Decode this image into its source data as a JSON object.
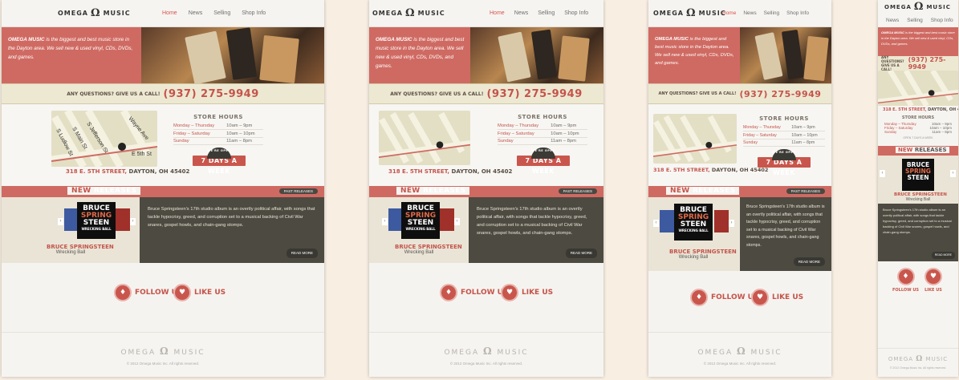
{
  "brand": {
    "name_left": "OMEGA",
    "symbol": "Ω",
    "name_right": "MUSIC"
  },
  "nav": [
    "Home",
    "News",
    "Selling",
    "Shop Info"
  ],
  "hero": {
    "brand": "OMEGA MUSIC",
    "text": "is the biggest and best music store in the Dayton area. We sell new & used vinyl, CDs, DVDs, and games."
  },
  "callbar": {
    "question": "ANY QUESTIONS? GIVE US A CALL!",
    "phone": "(937) 275-9949"
  },
  "map": {
    "streets": [
      "S Jefferson St",
      "S Main St",
      "S Ludlow St",
      "Wayne Ave",
      "E 5th St"
    ]
  },
  "address": {
    "street": "318 E. 5TH STREET,",
    "city": "DAYTON, OH 45402"
  },
  "hours": {
    "title": "STORE HOURS",
    "rows": [
      {
        "day": "Monday – Thursday",
        "time": "10am – 9pm"
      },
      {
        "day": "Friday – Saturday",
        "time": "10am – 10pm"
      },
      {
        "day": "Sunday",
        "time": "11am – 8pm"
      }
    ],
    "open_small": "WE'RE OPEN",
    "open_big": "7 DAYS A WEEK",
    "open_mobile": "OPEN 7 DAYS A WEEK"
  },
  "releases": {
    "title_new": "NEW",
    "title_rest": "RELEASES",
    "past": "PAST RELEASES"
  },
  "album": {
    "cover_lines": [
      "BRUCE",
      "SPRING",
      "STEEN"
    ],
    "cover_sub": "WRECKING BALL",
    "artist": "BRUCE SPRINGSTEEN",
    "title": "Wrecking Ball",
    "description": "Bruce Springsteen's 17th studio album is an overtly political affair, with songs that tackle hypocrisy, greed, and corruption set to a musical backing of Civil War snares, gospel howls, and chain-gang stomps.",
    "read_more": "READ MORE"
  },
  "social": {
    "follow": "FOLLOW US",
    "like": "LIKE US"
  },
  "footer": {
    "copyright": "© 2012 Omega Music Inc. All rights reserved."
  },
  "colors": {
    "accent": "#cf6a62",
    "text_red": "#c4544b",
    "dark": "#4d4a41",
    "cream": "#ede8d2"
  }
}
